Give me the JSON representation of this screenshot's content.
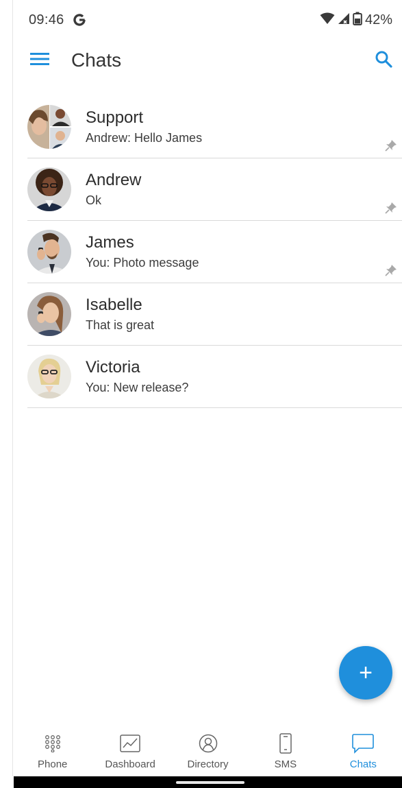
{
  "status_bar": {
    "time": "09:46",
    "battery": "42%"
  },
  "app_bar": {
    "title": "Chats"
  },
  "chats": [
    {
      "name": "Support",
      "preview": "Andrew: Hello James",
      "pinned": true
    },
    {
      "name": "Andrew",
      "preview": "Ok",
      "pinned": true
    },
    {
      "name": "James",
      "preview": "You: Photo message",
      "pinned": true
    },
    {
      "name": "Isabelle",
      "preview": "That is great",
      "pinned": false
    },
    {
      "name": "Victoria",
      "preview": "You: New release?",
      "pinned": false
    }
  ],
  "fab": {
    "icon": "plus-icon",
    "label": "+"
  },
  "bottom_nav": [
    {
      "label": "Phone",
      "icon": "dialpad-icon",
      "active": false
    },
    {
      "label": "Dashboard",
      "icon": "chart-icon",
      "active": false
    },
    {
      "label": "Directory",
      "icon": "contact-icon",
      "active": false
    },
    {
      "label": "SMS",
      "icon": "mobile-icon",
      "active": false
    },
    {
      "label": "Chats",
      "icon": "chat-bubble-icon",
      "active": true
    }
  ],
  "colors": {
    "accent": "#1f8fdc",
    "divider": "#d9d9d9",
    "pin": "#a9a9a9"
  }
}
